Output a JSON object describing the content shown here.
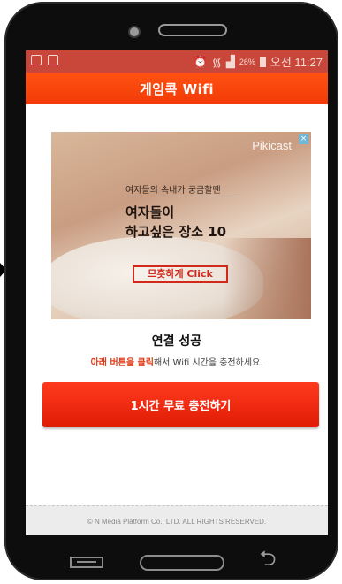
{
  "status_bar": {
    "left_icons": [
      "sync-icon",
      "image-icon"
    ],
    "alarm_icon": "alarm-icon",
    "wifi_icon": "wifi-icon",
    "signal_icon": "signal-icon",
    "battery_level": "26%",
    "time": "오전 11:27"
  },
  "app_bar": {
    "title": "게임콕 Wifi"
  },
  "ad": {
    "brand": "Pikicast",
    "close_label": "×",
    "kicker": "여자들의 속내가 궁금할땐",
    "headline_line1": "여자들이",
    "headline_line2": "하고싶은 장소 10",
    "cta": "므흣하게 Click"
  },
  "result": {
    "title": "연결 성공",
    "instruction_highlight": "아래 버튼을 클릭",
    "instruction_rest": "해서 Wifi 시간을 충전하세요."
  },
  "charge_button": {
    "label": "1시간 무료 충전하기"
  },
  "footer": {
    "copyright": "© N Media Platform Co., LTD. ALL RIGHTS RESERVED."
  },
  "nav_bar": {
    "back_glyph": "⮌"
  },
  "colors": {
    "accent": "#ff3e0b",
    "status_bar": "#c8463a",
    "button": "#ef2a10"
  }
}
